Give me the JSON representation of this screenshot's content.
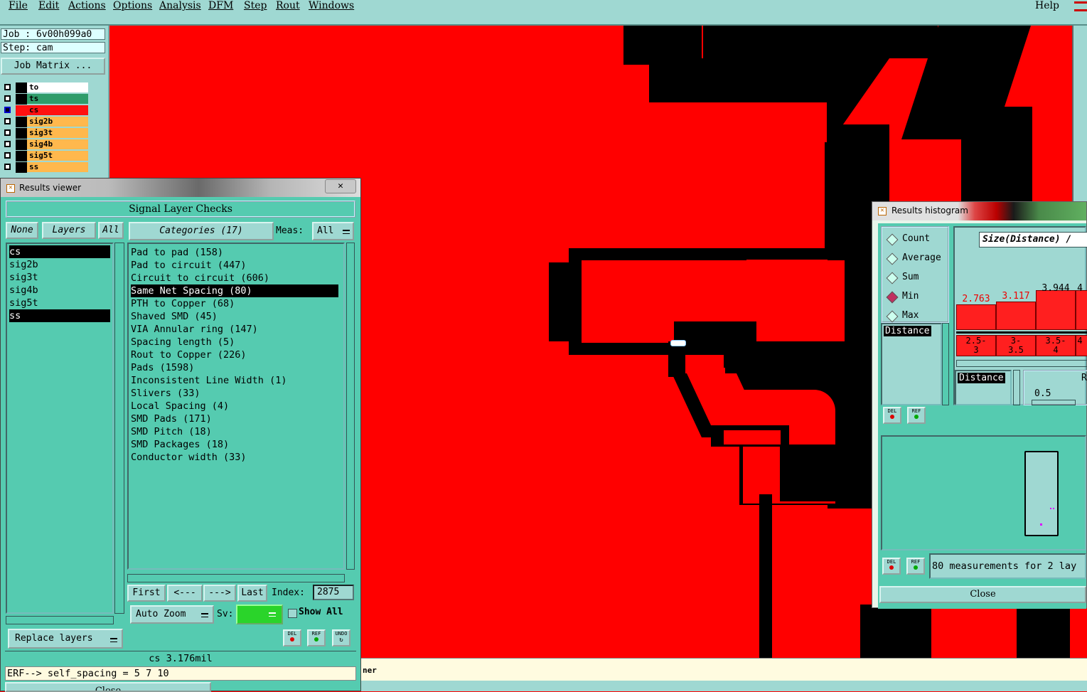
{
  "menu": {
    "items": [
      "File",
      "Edit",
      "Actions",
      "Options",
      "Analysis",
      "DFM",
      "Step",
      "Rout",
      "Windows"
    ],
    "help": "Help"
  },
  "job": {
    "job_line": "Job : 6v00h099a0",
    "step_line": "Step: cam",
    "matrix_button": "Job Matrix ..."
  },
  "layers": [
    {
      "name": "to",
      "color": "#ffffff",
      "selected": false
    },
    {
      "name": "ts",
      "color": "#2e9c6a",
      "selected": false
    },
    {
      "name": "cs",
      "color": "#ff1010",
      "selected": true
    },
    {
      "name": "sig2b",
      "color": "#ffb84d",
      "selected": false
    },
    {
      "name": "sig3t",
      "color": "#ffb84d",
      "selected": false
    },
    {
      "name": "sig4b",
      "color": "#ffb84d",
      "selected": false
    },
    {
      "name": "sig5t",
      "color": "#ffb84d",
      "selected": false
    },
    {
      "name": "ss",
      "color": "#ffb84d",
      "selected": false
    }
  ],
  "results_viewer": {
    "title": "Results viewer",
    "header": "Signal Layer Checks",
    "none_btn": "None",
    "layers_btn": "Layers",
    "all_btn": "All",
    "categories_btn": "Categories (17)",
    "meas_label": "Meas:",
    "meas_value": "All",
    "layer_list": [
      {
        "name": "cs",
        "selected": true
      },
      {
        "name": "sig2b",
        "selected": false
      },
      {
        "name": "sig3t",
        "selected": false
      },
      {
        "name": "sig4b",
        "selected": false
      },
      {
        "name": "sig5t",
        "selected": false
      },
      {
        "name": "ss",
        "selected": true
      }
    ],
    "categories": [
      {
        "label": "Pad to pad (158)",
        "selected": false
      },
      {
        "label": "Pad to circuit (447)",
        "selected": false
      },
      {
        "label": "Circuit to circuit (606)",
        "selected": false
      },
      {
        "label": "Same Net Spacing (80)",
        "selected": true
      },
      {
        "label": "PTH to Copper (68)",
        "selected": false
      },
      {
        "label": "Shaved SMD (45)",
        "selected": false
      },
      {
        "label": "VIA Annular ring (147)",
        "selected": false
      },
      {
        "label": "Spacing length (5)",
        "selected": false
      },
      {
        "label": "Rout to Copper (226)",
        "selected": false
      },
      {
        "label": "Pads (1598)",
        "selected": false
      },
      {
        "label": "Inconsistent Line Width (1)",
        "selected": false
      },
      {
        "label": "Slivers (33)",
        "selected": false
      },
      {
        "label": "Local Spacing (4)",
        "selected": false
      },
      {
        "label": "SMD Pads (171)",
        "selected": false
      },
      {
        "label": "SMD Pitch (18)",
        "selected": false
      },
      {
        "label": "SMD Packages (18)",
        "selected": false
      },
      {
        "label": "Conductor width (33)",
        "selected": false
      }
    ],
    "first_btn": "First",
    "prev_btn": "<---",
    "next_btn": "--->",
    "last_btn": "Last",
    "index_label": "Index:",
    "index_value": "2875",
    "autozoom_btn": "Auto Zoom",
    "sv_label": "Sv:",
    "show_all_label": "Show All",
    "replace_layers_btn": "Replace layers",
    "del_btn": "DEL",
    "ref_btn": "REF",
    "undo_btn": "UNDO",
    "status": "cs 3.176mil",
    "close_btn": "Close"
  },
  "command_line": "ERF--> self_spacing = 5 7 10",
  "status_fragment": "ner",
  "histogram": {
    "title": "Results histogram",
    "modes": [
      {
        "label": "Count",
        "on": false
      },
      {
        "label": "Average",
        "on": false
      },
      {
        "label": "Sum",
        "on": false
      },
      {
        "label": "Min",
        "on": true
      },
      {
        "label": "Max",
        "on": false
      }
    ],
    "x_list_item": "Distance",
    "x_field": "Distance",
    "chart_title": "Size(Distance) /",
    "bins": [
      {
        "range": "2.5-\n3",
        "value": "2.763"
      },
      {
        "range": "3-\n3.5",
        "value": "3.117"
      },
      {
        "range": "3.5-\n4",
        "value": "3.944"
      },
      {
        "range": "4",
        "value": "4"
      }
    ],
    "slider_value": "0.5",
    "slider_label_partial": "R",
    "del_btn": "DEL",
    "ref_btn": "REF",
    "summary": "80 measurements for 2 lay",
    "close_btn": "Close"
  }
}
